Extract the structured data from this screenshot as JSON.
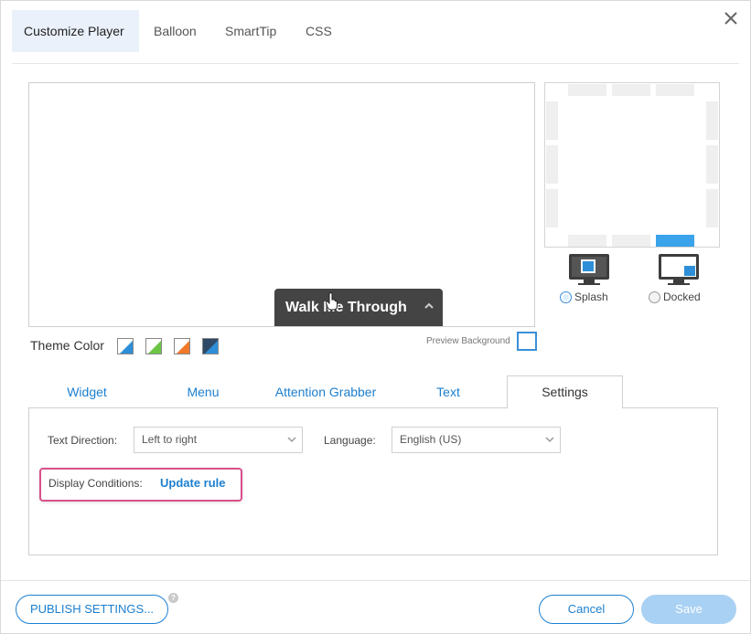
{
  "tabs": [
    {
      "label": "Customize Player",
      "active": true
    },
    {
      "label": "Balloon",
      "active": false
    },
    {
      "label": "SmartTip",
      "active": false
    },
    {
      "label": "CSS",
      "active": false
    }
  ],
  "close_icon": "close-icon",
  "preview": {
    "widget_label": "Walk Me Through",
    "widget_color": "#444444",
    "accent_color": "#3a8fd9"
  },
  "theme": {
    "label": "Theme Color",
    "colors": [
      "#2e8fd8",
      "#6cc644",
      "#f07a2a",
      "#2e4a66"
    ]
  },
  "preview_background": {
    "label": "Preview Background"
  },
  "position_modes": [
    {
      "label": "Splash",
      "selected": true,
      "icon": "monitor-splash-icon"
    },
    {
      "label": "Docked",
      "selected": false,
      "icon": "monitor-docked-icon"
    }
  ],
  "section_tabs": [
    {
      "label": "Widget",
      "active": false
    },
    {
      "label": "Menu",
      "active": false
    },
    {
      "label": "Attention Grabber",
      "active": false
    },
    {
      "label": "Text",
      "active": false
    },
    {
      "label": "Settings",
      "active": true
    }
  ],
  "settings": {
    "text_direction_label": "Text Direction:",
    "text_direction_value": "Left to right",
    "language_label": "Language:",
    "language_value": "English (US)",
    "display_conditions_label": "Display Conditions:",
    "update_rule_label": "Update rule"
  },
  "footer": {
    "publish_label": "PUBLISH SETTINGS...",
    "help_icon": "?",
    "cancel_label": "Cancel",
    "save_label": "Save"
  }
}
